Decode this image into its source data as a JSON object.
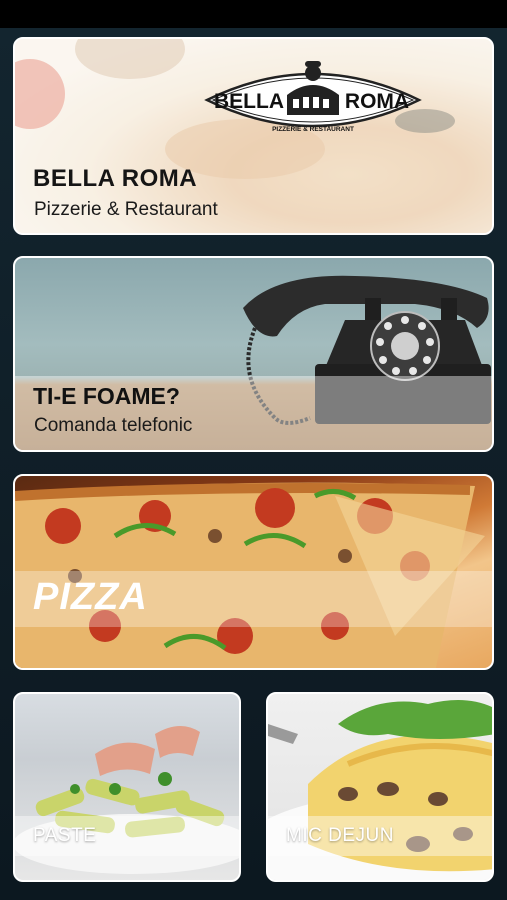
{
  "cards": {
    "restaurant": {
      "title": "BELLA ROMA",
      "subtitle": "Pizzerie & Restaurant",
      "logo": {
        "left_word": "BELLA",
        "right_word": "ROMA",
        "arc_text": "PIZZERIE & RESTAURANT"
      }
    },
    "order": {
      "title": "TI-E FOAME?",
      "subtitle": "Comanda telefonic"
    },
    "pizza": {
      "title": "PIZZA"
    },
    "pasta": {
      "title": "PASTE"
    },
    "breakfast": {
      "title": "MIC DEJUN"
    }
  },
  "icons": [
    "colosseum-logo-icon",
    "rotary-phone-image",
    "pizza-image",
    "pasta-image",
    "omelette-image"
  ],
  "colors": {
    "background": "#0d1a22",
    "card_border": "#ffffff",
    "title_dark": "#151515",
    "title_light": "#ffffff"
  }
}
